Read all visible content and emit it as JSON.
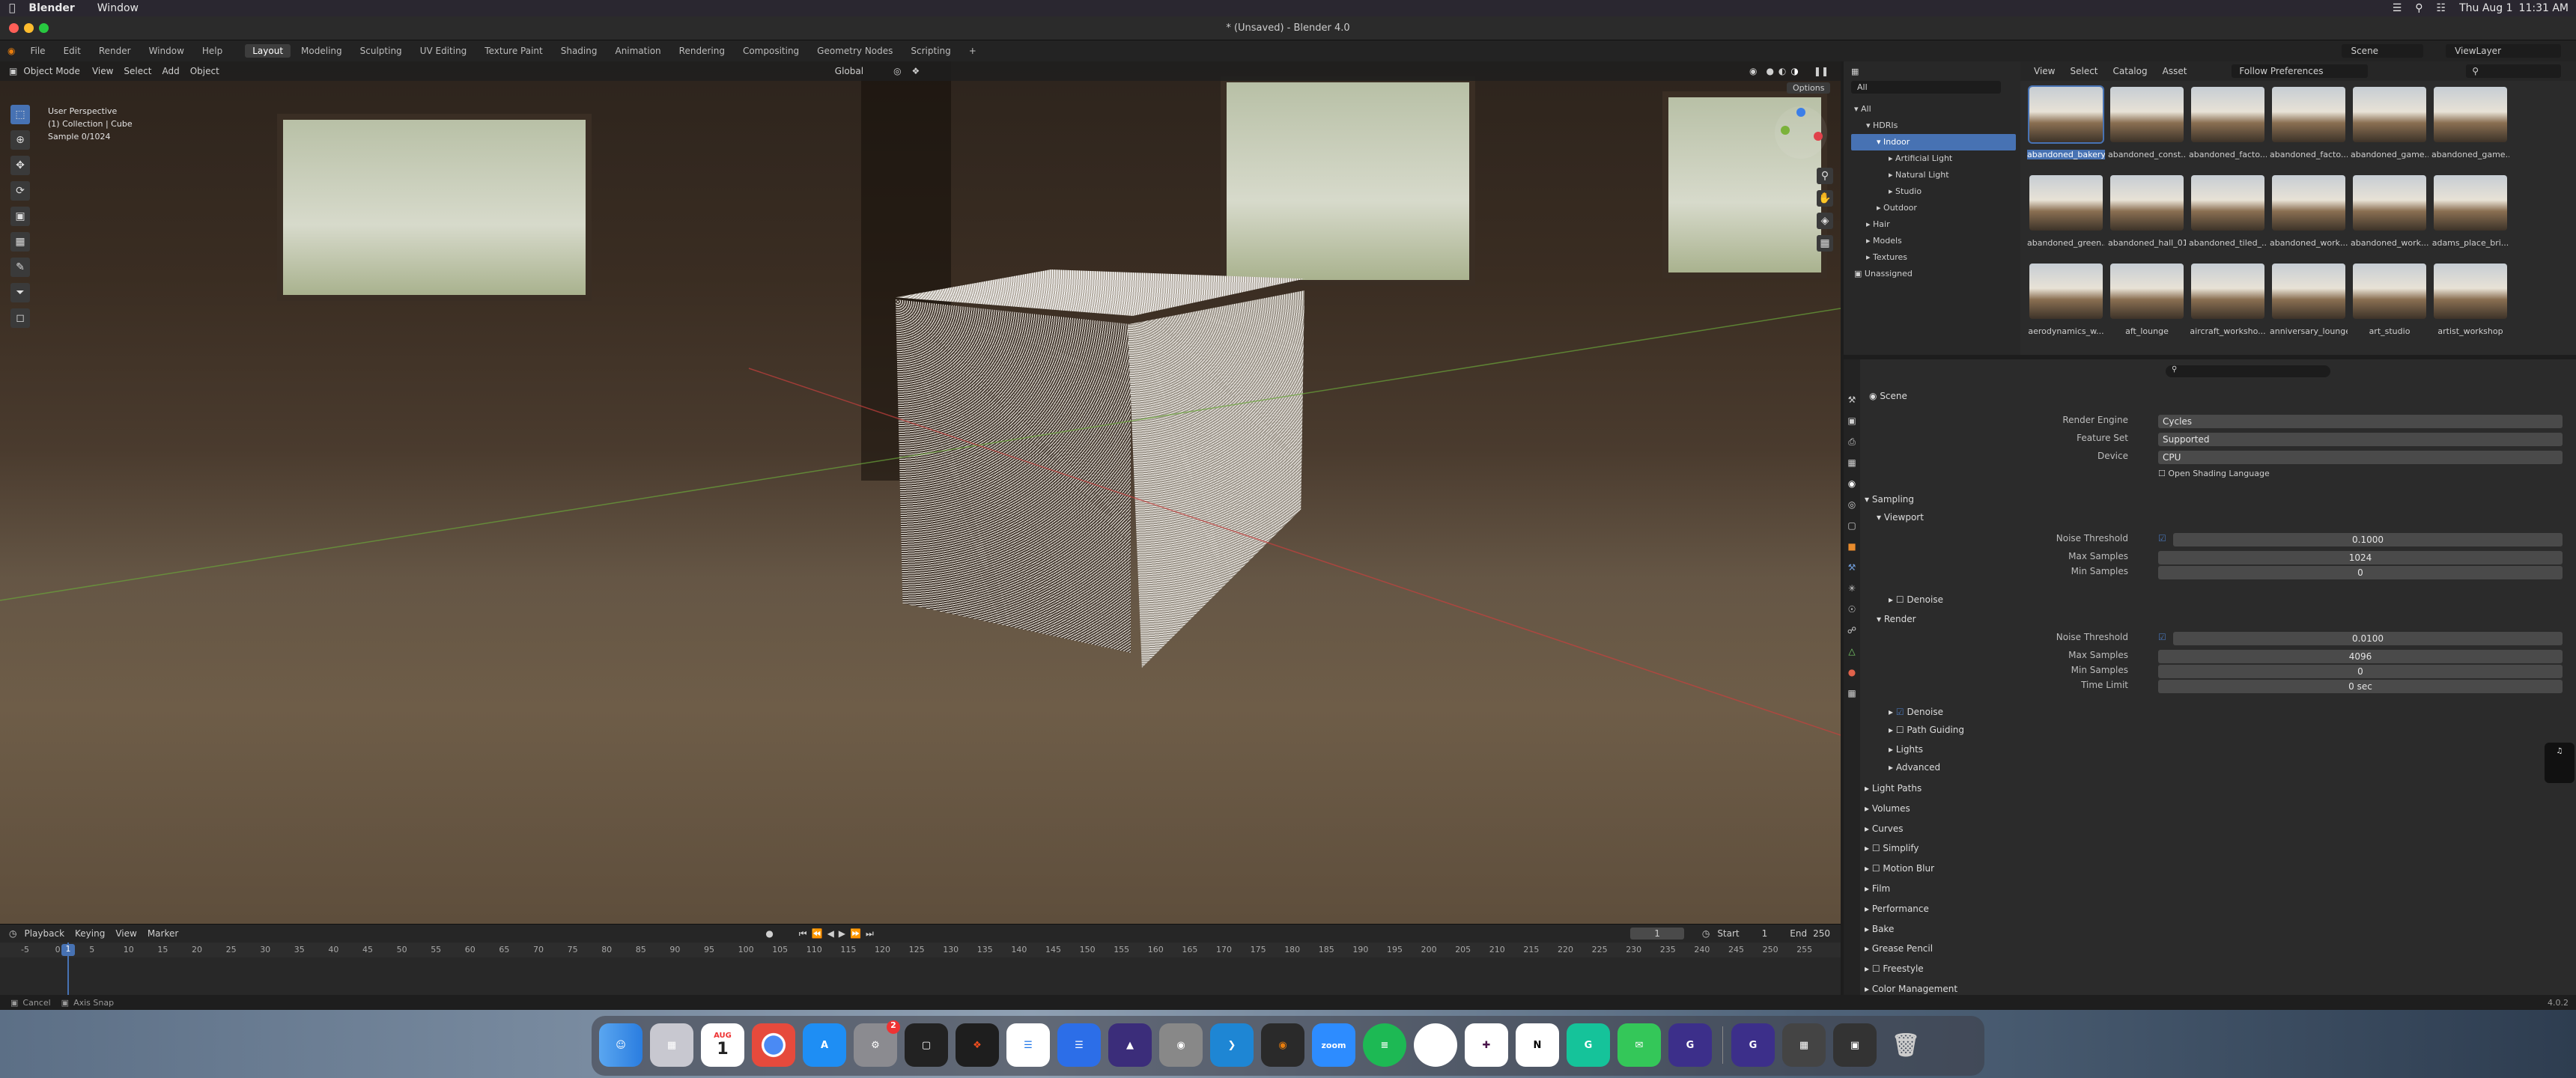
{
  "menubar": {
    "app": "Blender",
    "menu_window": "Window",
    "date": "Thu Aug 1",
    "time": "11:31 AM"
  },
  "window": {
    "title": "* (Unsaved) - Blender 4.0"
  },
  "topmenu": {
    "items": [
      "File",
      "Edit",
      "Render",
      "Window",
      "Help"
    ],
    "workspaces": [
      "Layout",
      "Modeling",
      "Sculpting",
      "UV Editing",
      "Texture Paint",
      "Shading",
      "Animation",
      "Rendering",
      "Compositing",
      "Geometry Nodes",
      "Scripting"
    ],
    "scene": "Scene",
    "view_layer": "ViewLayer"
  },
  "viewport": {
    "mode": "Object Mode",
    "menus": [
      "View",
      "Select",
      "Add",
      "Object"
    ],
    "orientation": "Global",
    "options": "Options",
    "info": [
      "User Perspective",
      "(1) Collection | Cube",
      "Sample 0/1024"
    ]
  },
  "timeline": {
    "menus": [
      "Playback",
      "Keying",
      "View",
      "Marker"
    ],
    "current_frame": "1",
    "start_label": "Start",
    "start": "1",
    "end_label": "End",
    "end": "250",
    "ticks": [
      "-5",
      "0",
      "5",
      "10",
      "15",
      "20",
      "25",
      "30",
      "35",
      "40",
      "45",
      "50",
      "55",
      "60",
      "65",
      "70",
      "75",
      "80",
      "85",
      "90",
      "95",
      "100",
      "105",
      "110",
      "115",
      "120",
      "125",
      "130",
      "135",
      "140",
      "145",
      "150",
      "155",
      "160",
      "165",
      "170",
      "175",
      "180",
      "185",
      "190",
      "195",
      "200",
      "205",
      "210",
      "215",
      "220",
      "225",
      "230",
      "235",
      "240",
      "245",
      "250",
      "255"
    ]
  },
  "statusbar": {
    "left1": "Cancel",
    "left2": "Axis Snap",
    "version": "4.0.2"
  },
  "outliner": {
    "filter": "All",
    "tree": [
      "All",
      "HDRIs",
      "Indoor",
      "Artificial Light",
      "Natural Light",
      "Studio",
      "Outdoor",
      "Hair",
      "Models",
      "Textures",
      "Unassigned"
    ]
  },
  "assets": {
    "menus": [
      "View",
      "Select",
      "Catalog",
      "Asset"
    ],
    "library": "Follow Preferences",
    "items": [
      "abandoned_bakery",
      "abandoned_const...",
      "abandoned_facto...",
      "abandoned_facto...",
      "abandoned_game...",
      "abandoned_game...",
      "abandoned_green...",
      "abandoned_hall_01",
      "abandoned_tiled_...",
      "abandoned_work...",
      "abandoned_work...",
      "adams_place_bri...",
      "aerodynamics_w...",
      "aft_lounge",
      "aircraft_worksho...",
      "anniversary_lounge",
      "art_studio",
      "artist_workshop"
    ]
  },
  "properties": {
    "context": "Scene",
    "render_engine_label": "Render Engine",
    "render_engine": "Cycles",
    "feature_set_label": "Feature Set",
    "feature_set": "Supported",
    "device_label": "Device",
    "device": "CPU",
    "osl": "Open Shading Language",
    "sampling": "Sampling",
    "viewport": "Viewport",
    "noise_threshold_label": "Noise Threshold",
    "vp_noise_threshold": "0.1000",
    "max_samples_label": "Max Samples",
    "vp_max_samples": "1024",
    "min_samples_label": "Min Samples",
    "vp_min_samples": "0",
    "denoise": "Denoise",
    "render": "Render",
    "r_noise_threshold": "0.0100",
    "r_max_samples": "4096",
    "r_min_samples": "0",
    "time_limit_label": "Time Limit",
    "time_limit": "0 sec",
    "path_guiding": "Path Guiding",
    "lights": "Lights",
    "advanced": "Advanced",
    "sections": [
      "Light Paths",
      "Volumes",
      "Curves",
      "Simplify",
      "Motion Blur",
      "Film",
      "Performance",
      "Bake",
      "Grease Pencil",
      "Freestyle",
      "Color Management"
    ]
  },
  "dock": {
    "calendar_month": "AUG",
    "calendar_day": "1",
    "badge": "2",
    "zoom": "zoom"
  }
}
